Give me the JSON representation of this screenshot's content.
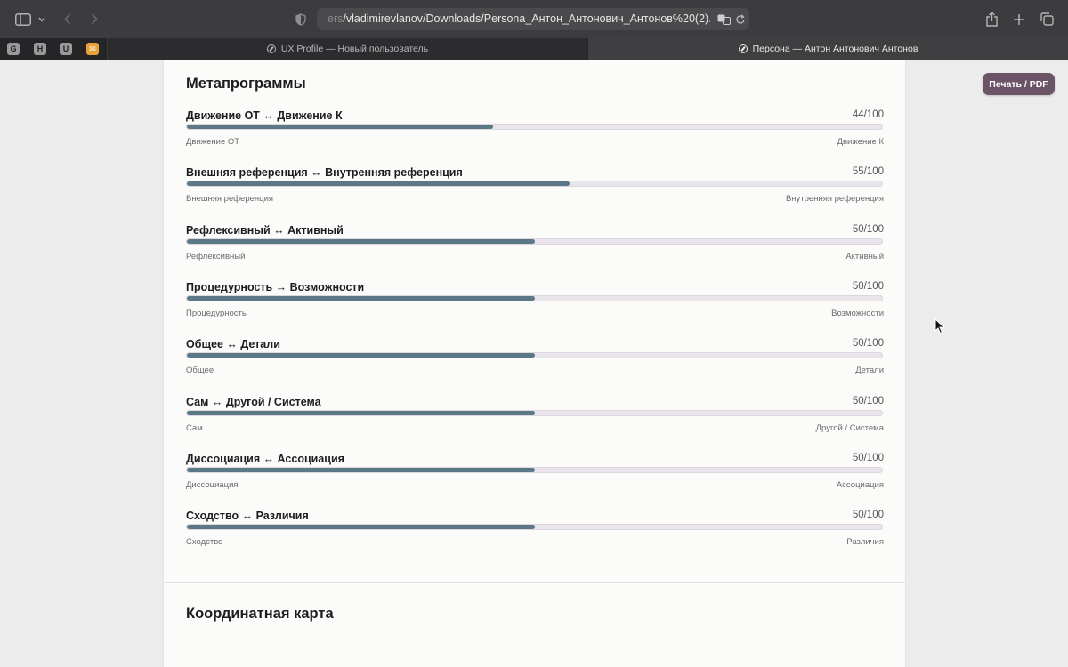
{
  "browser": {
    "url_faded": "ers",
    "url": "/vladimirevlanov/Downloads/Persona_Антон_Антонович_Антонов%20(2).html",
    "favorites": [
      {
        "name": "G",
        "icon": "g-favicon"
      },
      {
        "name": "H",
        "icon": "h-favicon"
      },
      {
        "name": "U",
        "icon": "u-favicon"
      },
      {
        "name": "",
        "icon": "mail-favicon"
      }
    ],
    "tabs": [
      {
        "title": "UX Profile — Новый пользователь",
        "active": false
      },
      {
        "title": "Персона — Антон Антонович Антонов",
        "active": true
      }
    ]
  },
  "page": {
    "section_title": "Метапрограммы",
    "next_section_title": "Координатная карта",
    "print_button": "Печать / PDF",
    "metaprograms": [
      {
        "name": "Движение ОТ ↔ Движение К",
        "score": "44/100",
        "value": 44,
        "left": "Движение ОТ",
        "right": "Движение К"
      },
      {
        "name": "Внешняя референция ↔ Внутренняя референция",
        "score": "55/100",
        "value": 55,
        "left": "Внешняя референция",
        "right": "Внутренняя референция"
      },
      {
        "name": "Рефлексивный ↔ Активный",
        "score": "50/100",
        "value": 50,
        "left": "Рефлексивный",
        "right": "Активный"
      },
      {
        "name": "Процедурность ↔ Возможности",
        "score": "50/100",
        "value": 50,
        "left": "Процедурность",
        "right": "Возможности"
      },
      {
        "name": "Общее ↔ Детали",
        "score": "50/100",
        "value": 50,
        "left": "Общее",
        "right": "Детали"
      },
      {
        "name": "Сам ↔ Другой / Система",
        "score": "50/100",
        "value": 50,
        "left": "Сам",
        "right": "Другой / Система"
      },
      {
        "name": "Диссоциация ↔ Ассоциация",
        "score": "50/100",
        "value": 50,
        "left": "Диссоциация",
        "right": "Ассоциация"
      },
      {
        "name": "Сходство ↔ Различия",
        "score": "50/100",
        "value": 50,
        "left": "Сходство",
        "right": "Различия"
      }
    ]
  },
  "colors": {
    "bar_fill": "#5b7886",
    "bar_track": "#e9e5ea",
    "print_button": "#6b5468"
  }
}
